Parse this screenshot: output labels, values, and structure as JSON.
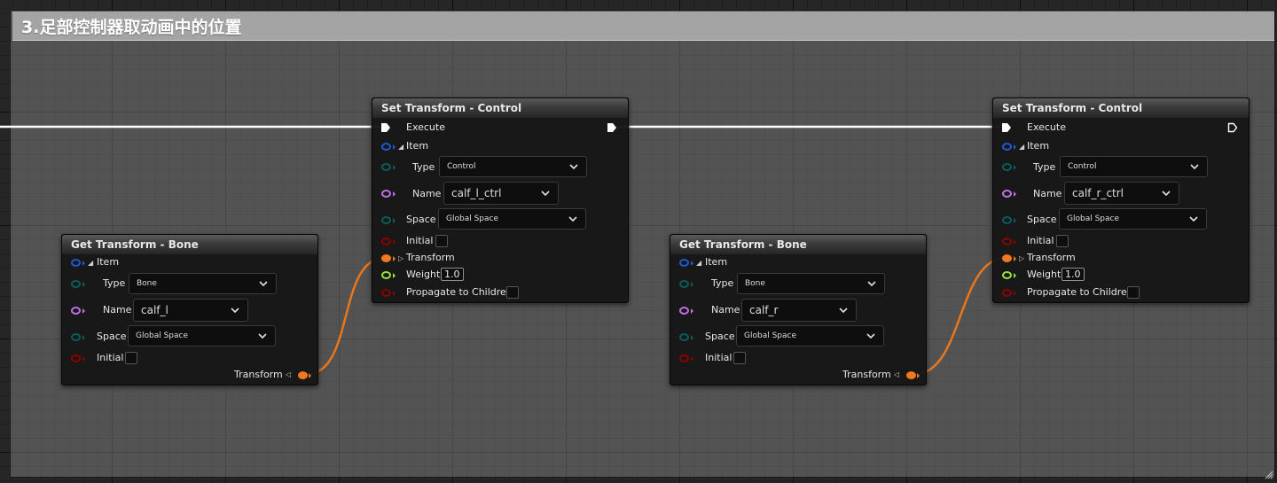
{
  "comment": {
    "title": "3.足部控制器取动画中的位置"
  },
  "colors": {
    "struct_pin": "#0b5d5c",
    "name_pin": "#c070e6",
    "bool_pin": "#8b0000",
    "transform_pin": "#f07820",
    "float_pin": "#98e33b",
    "item_pin": "#1d5bd1",
    "wire_transform": "#e8771e",
    "wire_exec": "#ffffff"
  },
  "get_bone_left": {
    "title": "Get Transform - Bone",
    "item_label": "Item",
    "type_label": "Type",
    "type_value": "Bone",
    "name_label": "Name",
    "name_value": "calf_l",
    "space_label": "Space",
    "space_value": "Global Space",
    "initial_label": "Initial",
    "transform_label": "Transform"
  },
  "set_control_left": {
    "title": "Set Transform - Control",
    "execute_label": "Execute",
    "item_label": "Item",
    "type_label": "Type",
    "type_value": "Control",
    "name_label": "Name",
    "name_value": "calf_l_ctrl",
    "space_label": "Space",
    "space_value": "Global Space",
    "initial_label": "Initial",
    "transform_label": "Transform",
    "weight_label": "Weight",
    "weight_value": "1.0",
    "propagate_label": "Propagate to Children"
  },
  "get_bone_right": {
    "title": "Get Transform - Bone",
    "item_label": "Item",
    "type_label": "Type",
    "type_value": "Bone",
    "name_label": "Name",
    "name_value": "calf_r",
    "space_label": "Space",
    "space_value": "Global Space",
    "initial_label": "Initial",
    "transform_label": "Transform"
  },
  "set_control_right": {
    "title": "Set Transform - Control",
    "execute_label": "Execute",
    "item_label": "Item",
    "type_label": "Type",
    "type_value": "Control",
    "name_label": "Name",
    "name_value": "calf_r_ctrl",
    "space_label": "Space",
    "space_value": "Global Space",
    "initial_label": "Initial",
    "transform_label": "Transform",
    "weight_label": "Weight",
    "weight_value": "1.0",
    "propagate_label": "Propagate to Children"
  }
}
